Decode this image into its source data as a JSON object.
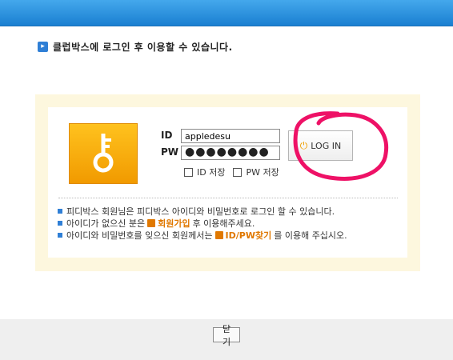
{
  "notice": {
    "text": "클럽박스에 로그인 후 이용할 수 있습니다."
  },
  "login": {
    "id_label": "ID",
    "pw_label": "PW",
    "id_value": "appledesu",
    "pw_value": "●●●●●●●●",
    "button_label": "LOG IN",
    "save_id_label": "ID 저장",
    "save_pw_label": "PW 저장"
  },
  "info": {
    "line1": "피디박스 회원님은 피디박스 아이디와 비밀번호로 로그인 할 수 있습니다.",
    "line2_pre": "아이디가 없으신 분은",
    "line2_link": "회원가입",
    "line2_post": "후 이용해주세요.",
    "line3_pre": "아이디와 비밀번호를 잊으신 회원께서는",
    "line3_link": "ID/PW찾기",
    "line3_post": "를 이용해 주십시오."
  },
  "footer": {
    "close_label": "닫기"
  },
  "colors": {
    "topbar": "#1a7fd1",
    "panel": "#fdf7de",
    "key": "#f7a800",
    "scribble": "#ee1166"
  },
  "icons": [
    "key-icon",
    "power-icon",
    "bullet-icon"
  ]
}
